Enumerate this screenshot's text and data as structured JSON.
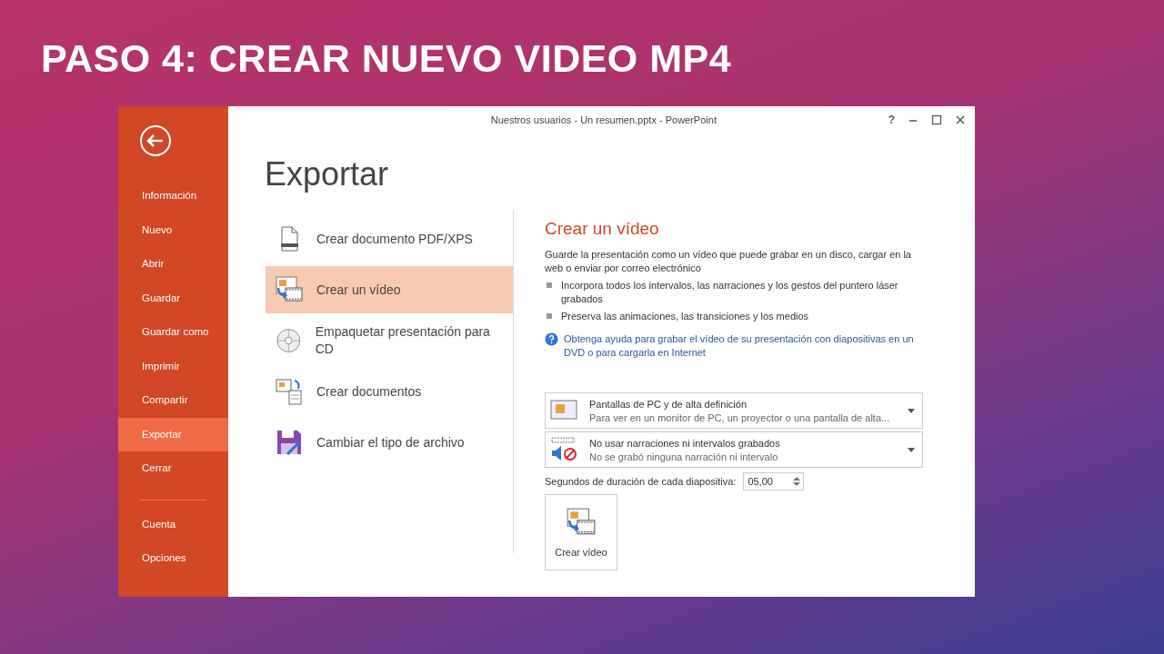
{
  "slide_title": "PASO 4: CREAR NUEVO VIDEO MP4",
  "window": {
    "title": "Nuestros usuarios - Un resumen.pptx - PowerPoint",
    "help": "?"
  },
  "sidebar": {
    "items": [
      {
        "label": "Información",
        "selected": false
      },
      {
        "label": "Nuevo",
        "selected": false
      },
      {
        "label": "Abrir",
        "selected": false
      },
      {
        "label": "Guardar",
        "selected": false
      },
      {
        "label": "Guardar como",
        "selected": false
      },
      {
        "label": "Imprimir",
        "selected": false
      },
      {
        "label": "Compartir",
        "selected": false
      },
      {
        "label": "Exportar",
        "selected": true
      },
      {
        "label": "Cerrar",
        "selected": false
      }
    ],
    "footer_items": [
      {
        "label": "Cuenta",
        "selected": false
      },
      {
        "label": "Opciones",
        "selected": false
      }
    ]
  },
  "page_title": "Exportar",
  "options": [
    {
      "kind": "pdf",
      "label": "Crear documento PDF/XPS",
      "selected": false
    },
    {
      "kind": "video",
      "label": "Crear un vídeo",
      "selected": true
    },
    {
      "kind": "cd",
      "label": "Empaquetar presentación para CD",
      "selected": false
    },
    {
      "kind": "handouts",
      "label": "Crear documentos",
      "selected": false
    },
    {
      "kind": "filetype",
      "label": "Cambiar el tipo de archivo",
      "selected": false
    }
  ],
  "detail": {
    "heading": "Crear un vídeo",
    "description": "Guarde la presentación como un vídeo que puede grabar en un disco, cargar en la web o enviar por correo electrónico",
    "bullets": [
      "Incorpora todos los intervalos, las narraciones y los gestos del puntero láser grabados",
      "Preserva las animaciones, las transiciones y los medios"
    ],
    "help_link": "Obtenga ayuda para grabar el vídeo de su presentación con diapositivas en un DVD o para cargarla en Internet",
    "dropdowns": [
      {
        "kind": "screen",
        "title": "Pantallas de PC y de alta definición",
        "subtitle": "Para ver en un monitor de PC, un proyector o una pantalla de alta..."
      },
      {
        "kind": "narration",
        "title": "No usar narraciones ni intervalos grabados",
        "subtitle": "No se grabó ninguna narración ni intervalo"
      }
    ],
    "duration": {
      "label": "Segundos de duración de cada diapositiva:",
      "value": "05,00"
    },
    "create_button": "Crear vídeo"
  }
}
